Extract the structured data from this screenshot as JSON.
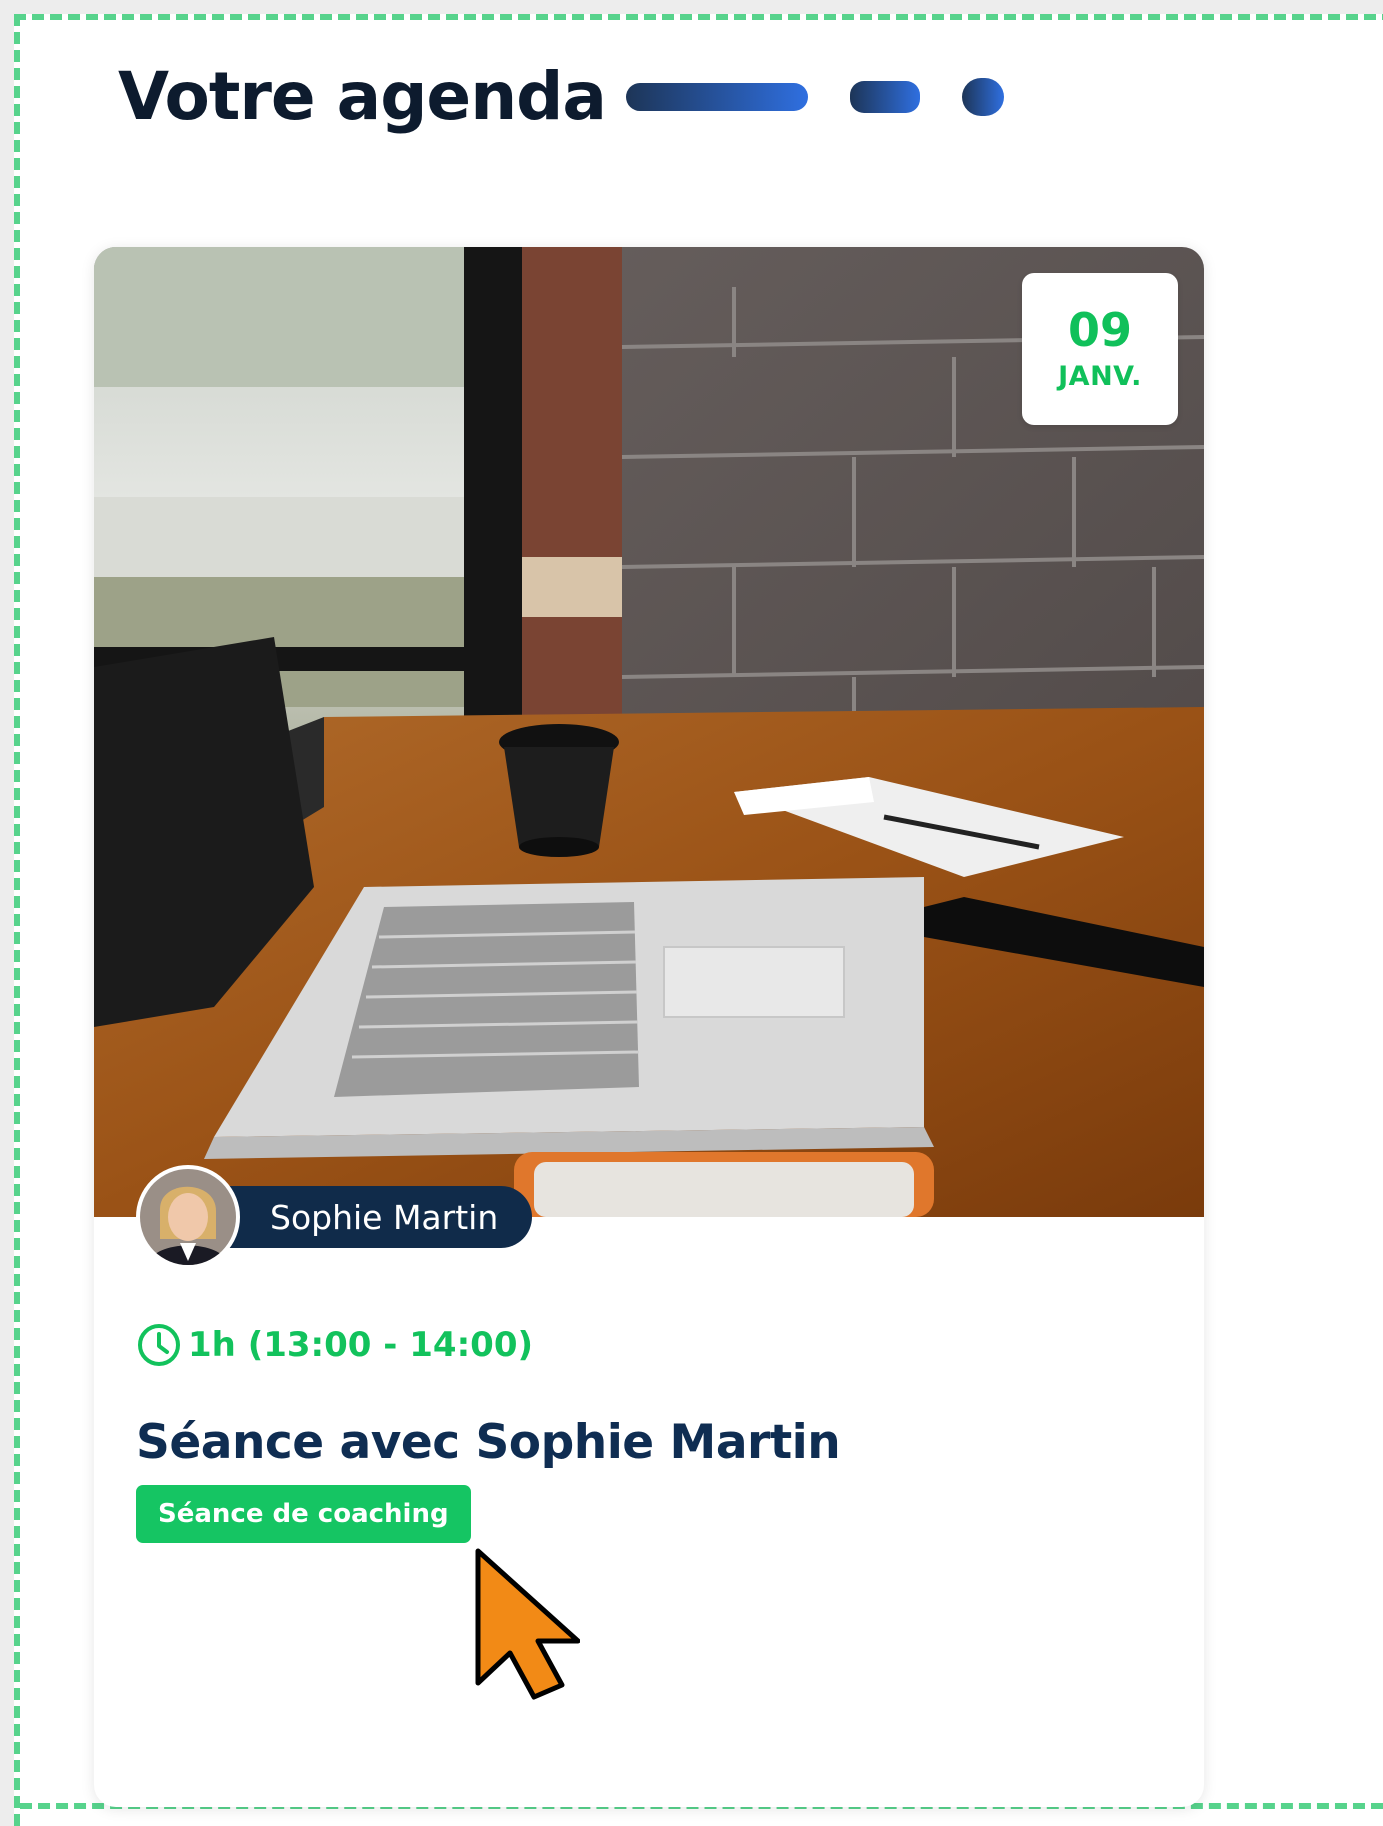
{
  "header": {
    "title": "Votre agenda"
  },
  "card": {
    "date": {
      "day": "09",
      "month": "JANV."
    },
    "host": {
      "name": "Sophie Martin"
    },
    "time": "1h (13:00 - 14:00)",
    "title": "Séance avec Sophie Martin",
    "tag": "Séance de coaching"
  },
  "icons": [
    "clock-icon",
    "mouse-cursor-icon"
  ],
  "colors": {
    "accent_green": "#12c25c",
    "navy": "#102b4a",
    "frame_dash": "#57d38c",
    "cursor": "#f28a16"
  }
}
